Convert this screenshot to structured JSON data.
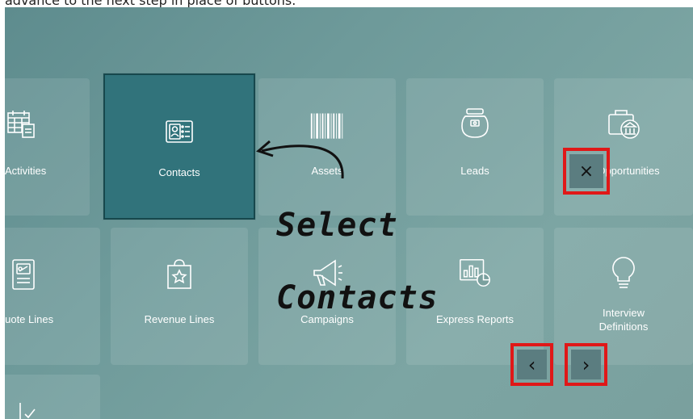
{
  "caption": "advance to the next step in place of buttons.",
  "tiles": {
    "activities": "Activities",
    "contacts": "Contacts",
    "assets": "Assets",
    "leads": "Leads",
    "opportunities": "Opportunities",
    "quote_lines": "Quote Lines",
    "revenue_lines": "Revenue Lines",
    "campaigns": "Campaigns",
    "express_reports": "Express Reports",
    "interview_definitions": "Interview Definitions"
  },
  "annotation": {
    "line1": "Select",
    "line2": "Contacts"
  },
  "controls": {
    "close": "×",
    "prev": "‹",
    "next": "›"
  },
  "colors": {
    "highlight": "#e01818",
    "selected_tile": "#31737b"
  }
}
